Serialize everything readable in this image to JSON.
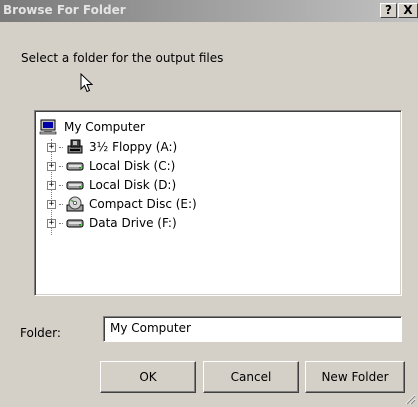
{
  "window": {
    "title": "Browse For Folder",
    "help_label": "?",
    "close_label": "X"
  },
  "prompt": "Select a folder for the output files",
  "tree": {
    "root": {
      "label": "My Computer",
      "icon": "computer-icon"
    },
    "items": [
      {
        "label": "3½ Floppy (A:)",
        "icon": "floppy-icon"
      },
      {
        "label": "Local Disk (C:)",
        "icon": "disk-icon"
      },
      {
        "label": "Local Disk (D:)",
        "icon": "disk-icon"
      },
      {
        "label": "Compact Disc (E:)",
        "icon": "cd-icon"
      },
      {
        "label": "Data Drive (F:)",
        "icon": "disk-icon"
      }
    ],
    "expander_label": "+"
  },
  "folder": {
    "label": "Folder:",
    "value": "My Computer"
  },
  "buttons": {
    "ok": "OK",
    "cancel": "Cancel",
    "new_folder": "New Folder"
  },
  "colors": {
    "dialog_bg": "#d4d0c8",
    "titlebar_start": "#7a7a7a",
    "titlebar_end": "#c2c2c2"
  }
}
